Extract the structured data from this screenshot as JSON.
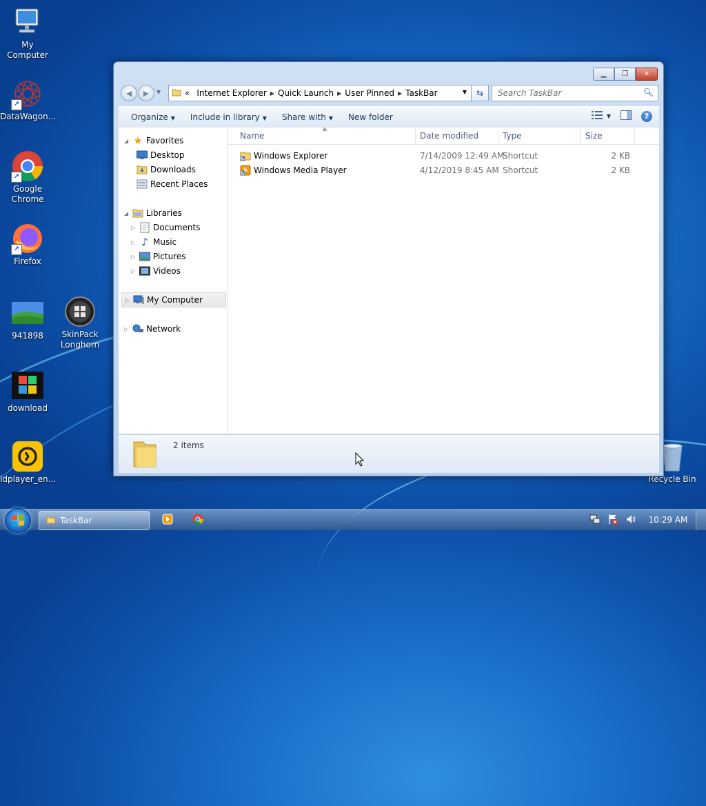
{
  "desktop": {
    "icons": [
      {
        "label": "My Computer"
      },
      {
        "label": "DataWagon..."
      },
      {
        "label": "Google\nChrome"
      },
      {
        "label": "Firefox"
      },
      {
        "label": "941898"
      },
      {
        "label": "SkinPack\nLonghorn"
      },
      {
        "label": "download"
      },
      {
        "label": "ldplayer_en..."
      },
      {
        "label": "Recycle Bin"
      }
    ]
  },
  "window": {
    "address": {
      "overflow": "«",
      "crumbs": [
        "Internet Explorer",
        "Quick Launch",
        "User Pinned",
        "TaskBar"
      ]
    },
    "search_placeholder": "Search TaskBar",
    "commands": {
      "organize": "Organize",
      "include": "Include in library",
      "share": "Share with",
      "new_folder": "New folder"
    },
    "nav": {
      "favorites": "Favorites",
      "desktop": "Desktop",
      "downloads": "Downloads",
      "recent": "Recent Places",
      "libraries": "Libraries",
      "documents": "Documents",
      "music": "Music",
      "pictures": "Pictures",
      "videos": "Videos",
      "computer": "My Computer",
      "network": "Network"
    },
    "columns": {
      "name": "Name",
      "date": "Date modified",
      "type": "Type",
      "size": "Size"
    },
    "files": [
      {
        "name": "Windows Explorer",
        "date": "7/14/2009 12:49 AM",
        "type": "Shortcut",
        "size": "2 KB"
      },
      {
        "name": "Windows Media Player",
        "date": "4/12/2019 8:45 AM",
        "type": "Shortcut",
        "size": "2 KB"
      }
    ],
    "status": "2 items"
  },
  "taskbar": {
    "active_window": "TaskBar",
    "clock": "10:29 AM"
  },
  "colors": {
    "accent": "#1a6dc8",
    "link": "#1e395b"
  }
}
